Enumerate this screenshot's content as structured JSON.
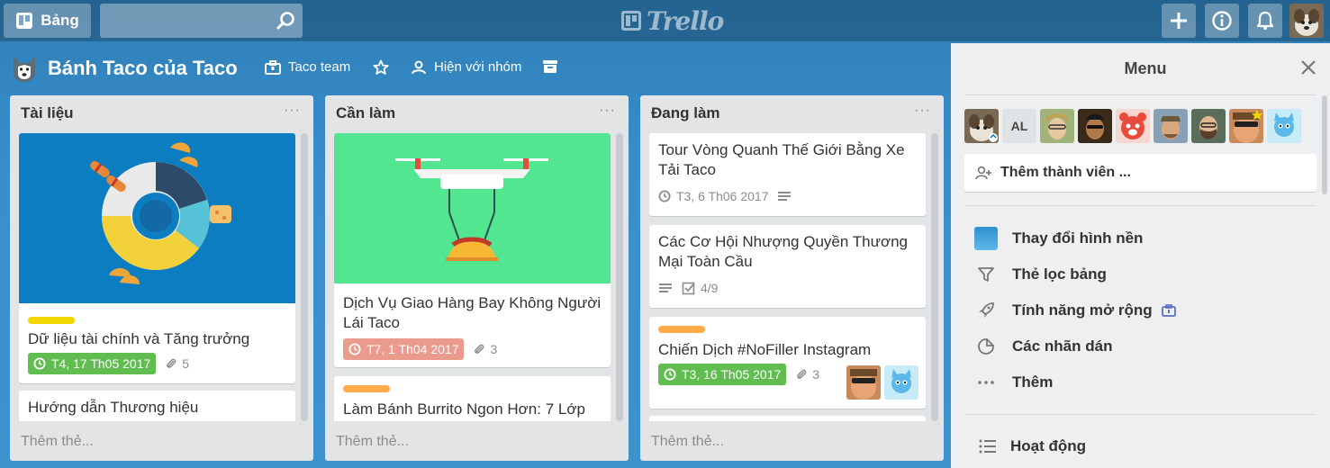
{
  "topbar": {
    "boards_label": "Bảng",
    "search_placeholder": "",
    "logo_text": "Trello"
  },
  "board": {
    "title": "Bánh Taco của Taco",
    "team": "Taco team",
    "visibility": "Hiện với nhóm"
  },
  "lists": [
    {
      "title": "Tài liệu",
      "add_card": "Thêm thẻ...",
      "cards": [
        {
          "title": "Dữ liệu tài chính và Tăng trưởng",
          "label_color": "#f2d600",
          "due": "T4, 17 Th05 2017",
          "attachments": "5"
        },
        {
          "title": "Hướng dẫn Thương hiệu"
        }
      ]
    },
    {
      "title": "Cần làm",
      "add_card": "Thêm thẻ...",
      "cards": [
        {
          "title": "Dịch Vụ Giao Hàng Bay Không Người Lái Taco",
          "due": "T7, 1 Th04 2017",
          "attachments": "3"
        },
        {
          "title": "Làm Bánh Burrito Ngon Hơn: 7 Lớp",
          "label_color": "#ffab4a"
        }
      ]
    },
    {
      "title": "Đang làm",
      "add_card": "Thêm thẻ...",
      "cards": [
        {
          "title": "Tour Vòng Quanh Thế Giới Bằng Xe Tải Taco",
          "due": "T3, 6 Th06 2017"
        },
        {
          "title": "Các Cơ Hội Nhượng Quyền Thương Mại Toàn Cầu",
          "checklist": "4/9"
        },
        {
          "title": "Chiến Dịch #NoFiller Instagram",
          "label_color": "#ffab4a",
          "due": "T3, 16 Th05 2017",
          "attachments": "3"
        }
      ]
    }
  ],
  "menu": {
    "title": "Menu",
    "member_initials": "AL",
    "add_member": "Thêm thành viên ...",
    "items": [
      {
        "label": "Thay đổi hình nền"
      },
      {
        "label": "Thẻ lọc bảng"
      },
      {
        "label": "Tính năng mở rộng"
      },
      {
        "label": "Các nhãn dán"
      },
      {
        "label": "Thêm"
      }
    ],
    "activity": "Hoạt động"
  },
  "colors": {
    "accent_blue": "#0079bf",
    "due_green": "#61bd4f",
    "due_red": "#eb9a8e",
    "label_yellow": "#f2d600",
    "label_orange": "#ffab4a"
  }
}
